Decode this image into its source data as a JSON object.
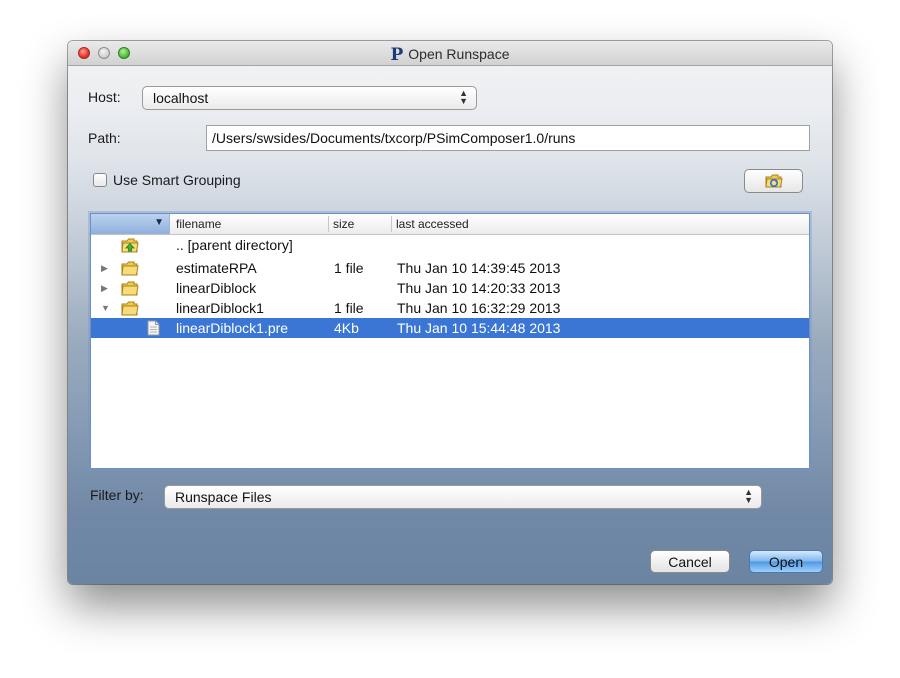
{
  "window": {
    "title": "Open Runspace",
    "app_logo_glyph": "P",
    "traffic_lights": [
      "close",
      "minimize",
      "zoom"
    ]
  },
  "host": {
    "label": "Host:",
    "value": "localhost"
  },
  "path": {
    "label": "Path:",
    "value": "/Users/swsides/Documents/txcorp/PSimComposer1.0/runs"
  },
  "smart_grouping": {
    "label": "Use Smart Grouping",
    "checked": false
  },
  "browse_button": {
    "icon": "folder-refresh-icon"
  },
  "table": {
    "sort_indicator": "▼",
    "columns": {
      "filename": "filename",
      "size": "size",
      "last_accessed": "last accessed"
    },
    "rows": [
      {
        "type": "parent",
        "expander": "",
        "icon": "parent-folder-icon",
        "filename": ".. [parent directory]",
        "size": "",
        "last_accessed": ""
      },
      {
        "type": "folder",
        "expander": "▶",
        "icon": "folder-icon",
        "filename": "estimateRPA",
        "size": "1 file",
        "last_accessed": "Thu Jan 10 14:39:45 2013"
      },
      {
        "type": "folder",
        "expander": "▶",
        "icon": "folder-icon",
        "filename": "linearDiblock",
        "size": "",
        "last_accessed": "Thu Jan 10 14:20:33 2013"
      },
      {
        "type": "folder",
        "expander": "▼",
        "icon": "folder-icon",
        "filename": "linearDiblock1",
        "size": "1 file",
        "last_accessed": "Thu Jan 10 16:32:29 2013"
      },
      {
        "type": "file",
        "expander": "",
        "icon": "file-icon",
        "filename": "linearDiblock1.pre",
        "size": "4Kb",
        "last_accessed": "Thu Jan 10 15:44:48 2013",
        "selected": true
      }
    ]
  },
  "filter": {
    "label": "Filter by:",
    "value": "Runspace Files"
  },
  "buttons": {
    "cancel": "Cancel",
    "open": "Open"
  },
  "colors": {
    "selection": "#3b76d4",
    "default_button": "#4f98e5"
  }
}
